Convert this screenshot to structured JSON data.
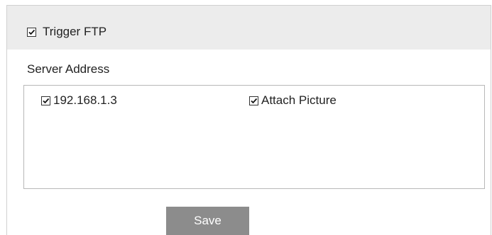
{
  "trigger": {
    "label": "Trigger FTP",
    "checked": true
  },
  "server": {
    "section_label": "Server Address",
    "entries": [
      {
        "address": "192.168.1.3",
        "address_checked": true,
        "attach_label": "Attach Picture",
        "attach_checked": true
      }
    ]
  },
  "actions": {
    "save_label": "Save"
  },
  "colors": {
    "header_bar": "#ececec",
    "save_button": "#8c8c8c",
    "save_text": "#ffffff"
  },
  "icons": {
    "checkbox": "checkbox-checked-icon"
  }
}
